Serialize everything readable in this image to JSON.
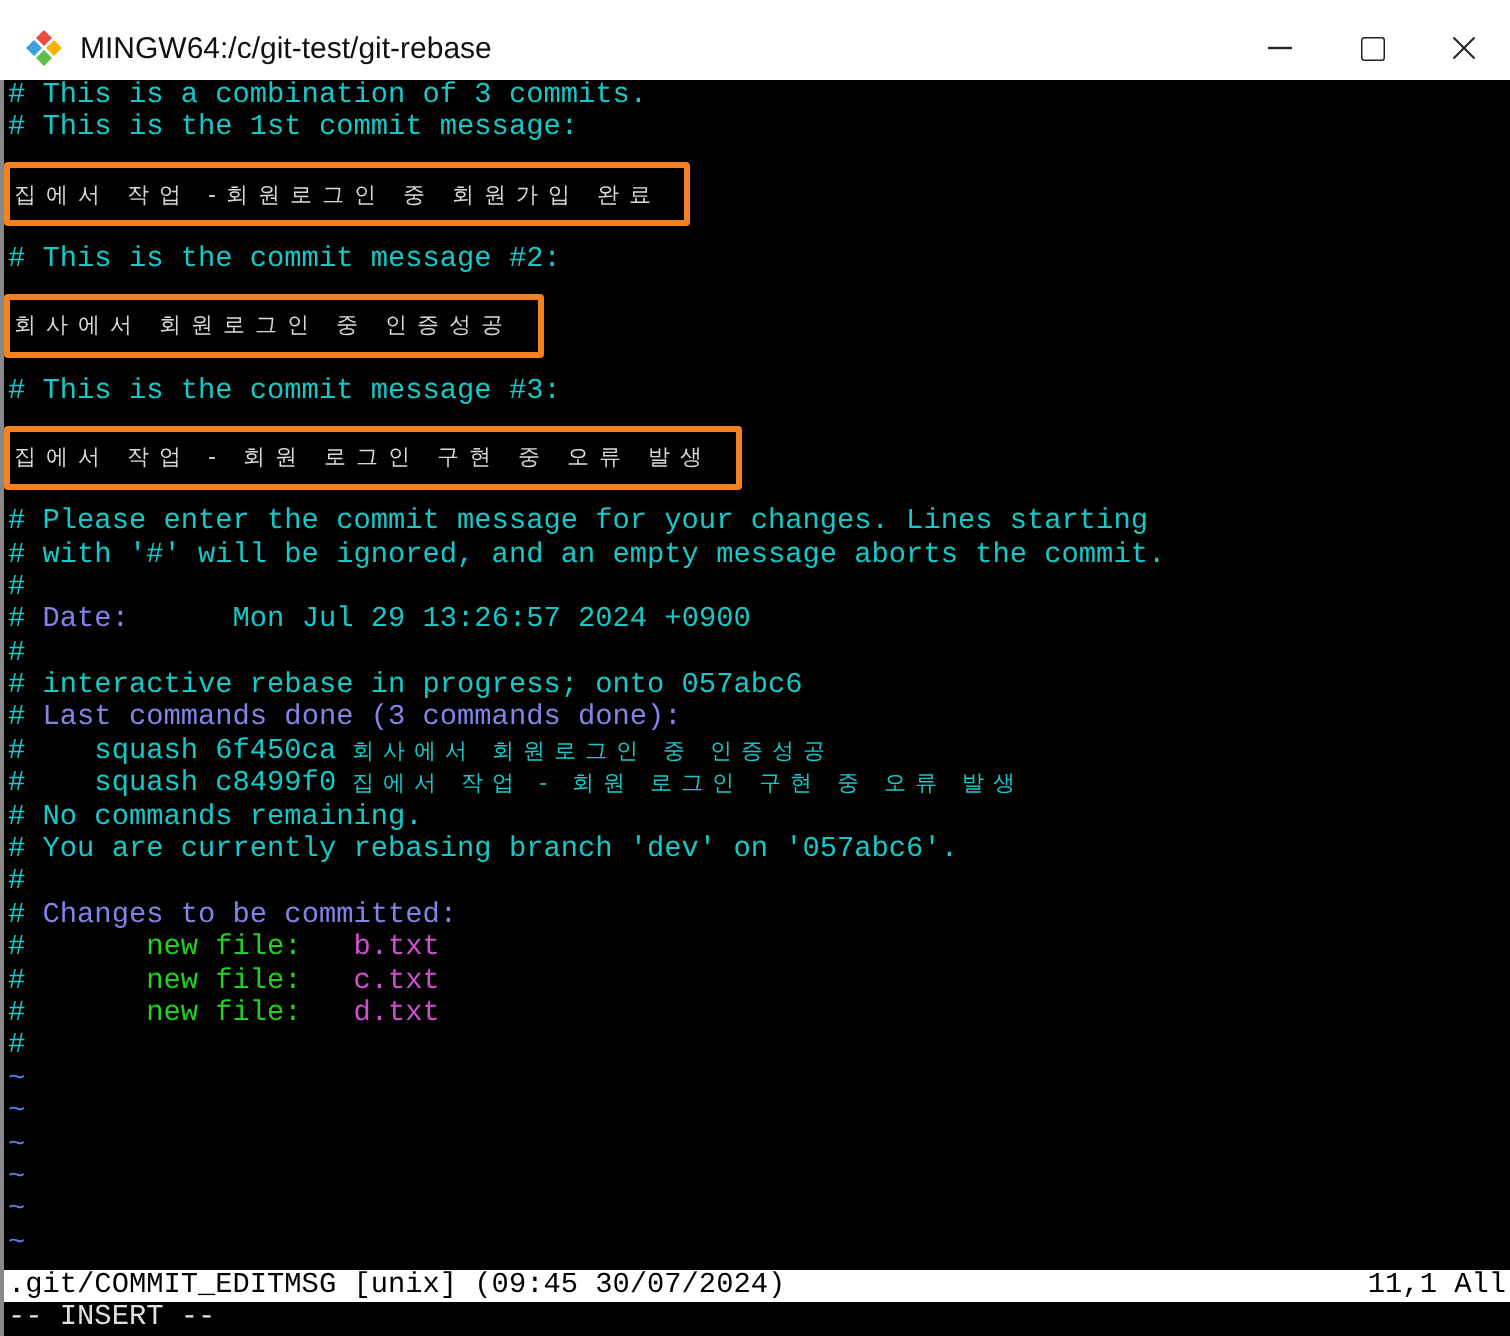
{
  "window": {
    "title": "MINGW64:/c/git-test/git-rebase"
  },
  "lines": [
    {
      "kind": "text",
      "segments": [
        {
          "text": "# This is a combination of 3 commits.",
          "color": "#16c8c8"
        }
      ]
    },
    {
      "kind": "text",
      "segments": [
        {
          "text": "# This is the 1st commit message:",
          "color": "#16c8c8"
        }
      ]
    },
    {
      "kind": "message",
      "text": "집에서 작업 -회원로그인 중 회원가입 완료"
    },
    {
      "kind": "text",
      "segments": [
        {
          "text": "# This is the commit message #2:",
          "color": "#16c8c8"
        }
      ]
    },
    {
      "kind": "message",
      "text": "회사에서 회원로그인 중 인증성공"
    },
    {
      "kind": "text",
      "segments": [
        {
          "text": "# This is the commit message #3:",
          "color": "#16c8c8"
        }
      ]
    },
    {
      "kind": "message",
      "text": "집에서 작업 - 회원 로그인 구현 중 오류 발생"
    },
    {
      "kind": "text",
      "segments": [
        {
          "text": "# Please enter the commit message for your changes. Lines starting",
          "color": "#16c8c8"
        }
      ]
    },
    {
      "kind": "text",
      "segments": [
        {
          "text": "# with '#' will be ignored, and an empty message aborts the commit.",
          "color": "#16c8c8"
        }
      ]
    },
    {
      "kind": "text",
      "segments": [
        {
          "text": "#",
          "color": "#16c8c8"
        }
      ]
    },
    {
      "kind": "text",
      "segments": [
        {
          "text": "#",
          "color": "#16c8c8"
        },
        {
          "text": " Date:",
          "color": "#8383ea"
        },
        {
          "text": "      Mon Jul 29 13:26:57 2024 +0900",
          "color": "#16c8c8"
        }
      ]
    },
    {
      "kind": "text",
      "segments": [
        {
          "text": "#",
          "color": "#16c8c8"
        }
      ]
    },
    {
      "kind": "text",
      "segments": [
        {
          "text": "# interactive rebase in progress; onto 057abc6",
          "color": "#16c8c8"
        }
      ]
    },
    {
      "kind": "text",
      "segments": [
        {
          "text": "#",
          "color": "#16c8c8"
        },
        {
          "text": " Last commands done (3 commands done):",
          "color": "#8383ea"
        }
      ]
    },
    {
      "kind": "text",
      "segments": [
        {
          "text": "#    squash 6f450ca",
          "color": "#16c8c8"
        },
        {
          "text": " 회사에서 회원로그인 중 인증성공",
          "color": "#16c8c8",
          "spaced": true
        }
      ]
    },
    {
      "kind": "text",
      "segments": [
        {
          "text": "#    squash c8499f0",
          "color": "#16c8c8"
        },
        {
          "text": " 집에서 작업 - 회원 로그인 구현 중 오류 발생",
          "color": "#16c8c8",
          "spaced": true
        }
      ]
    },
    {
      "kind": "text",
      "segments": [
        {
          "text": "# No commands remaining.",
          "color": "#16c8c8"
        }
      ]
    },
    {
      "kind": "text",
      "segments": [
        {
          "text": "# You are currently rebasing branch 'dev' on '057abc6'.",
          "color": "#16c8c8"
        }
      ]
    },
    {
      "kind": "text",
      "segments": [
        {
          "text": "#",
          "color": "#16c8c8"
        }
      ]
    },
    {
      "kind": "text",
      "segments": [
        {
          "text": "#",
          "color": "#16c8c8"
        },
        {
          "text": " Changes to be committed:",
          "color": "#8383ea"
        }
      ]
    },
    {
      "kind": "text",
      "segments": [
        {
          "text": "#",
          "color": "#16c8c8"
        },
        {
          "text": "       new file:",
          "color": "#22d022"
        },
        {
          "text": "   b.txt",
          "color": "#d24fd2"
        }
      ]
    },
    {
      "kind": "text",
      "segments": [
        {
          "text": "#",
          "color": "#16c8c8"
        },
        {
          "text": "       new file:",
          "color": "#22d022"
        },
        {
          "text": "   c.txt",
          "color": "#d24fd2"
        }
      ]
    },
    {
      "kind": "text",
      "segments": [
        {
          "text": "#",
          "color": "#16c8c8"
        },
        {
          "text": "       new file:",
          "color": "#22d022"
        },
        {
          "text": "   d.txt",
          "color": "#d24fd2"
        }
      ]
    },
    {
      "kind": "text",
      "segments": [
        {
          "text": "#",
          "color": "#16c8c8"
        }
      ]
    },
    {
      "kind": "tilde",
      "text": "~"
    },
    {
      "kind": "tilde",
      "text": "~"
    },
    {
      "kind": "tilde",
      "text": "~"
    },
    {
      "kind": "tilde",
      "text": "~"
    },
    {
      "kind": "tilde",
      "text": "~"
    },
    {
      "kind": "tilde",
      "text": "~"
    }
  ],
  "status_bar": {
    "file": ".git/COMMIT_EDITMSG [unix] (09:45 30/07/2024)",
    "position": "11,1 All"
  },
  "mode_line": "-- INSERT --"
}
